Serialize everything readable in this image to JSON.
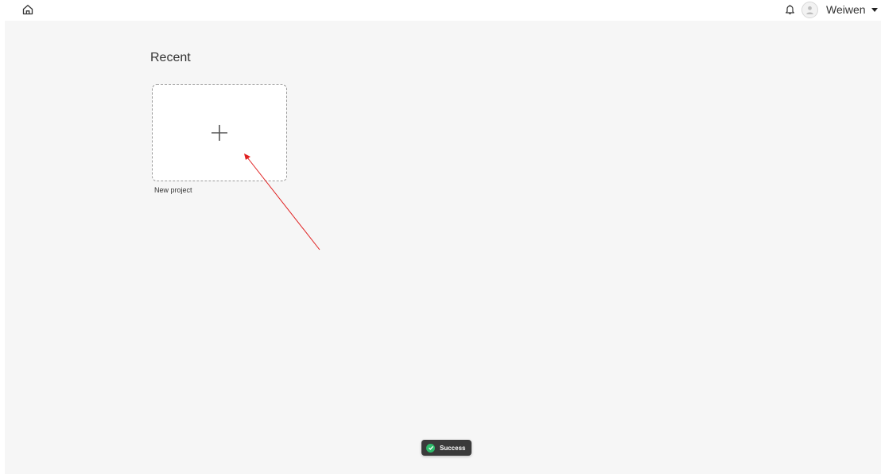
{
  "header": {
    "home_icon": "home-icon",
    "bell_icon": "bell-icon",
    "avatar_icon": "user-avatar-icon",
    "user_name": "Weiwen",
    "caret_icon": "caret-down-icon"
  },
  "main": {
    "section_title": "Recent",
    "new_project": {
      "icon": "plus-icon",
      "label": "New project"
    }
  },
  "toast": {
    "icon": "check-circle-icon",
    "text": "Success",
    "accent": "#2dbb6a"
  },
  "annotation": {
    "arrow_color": "#e02020"
  }
}
